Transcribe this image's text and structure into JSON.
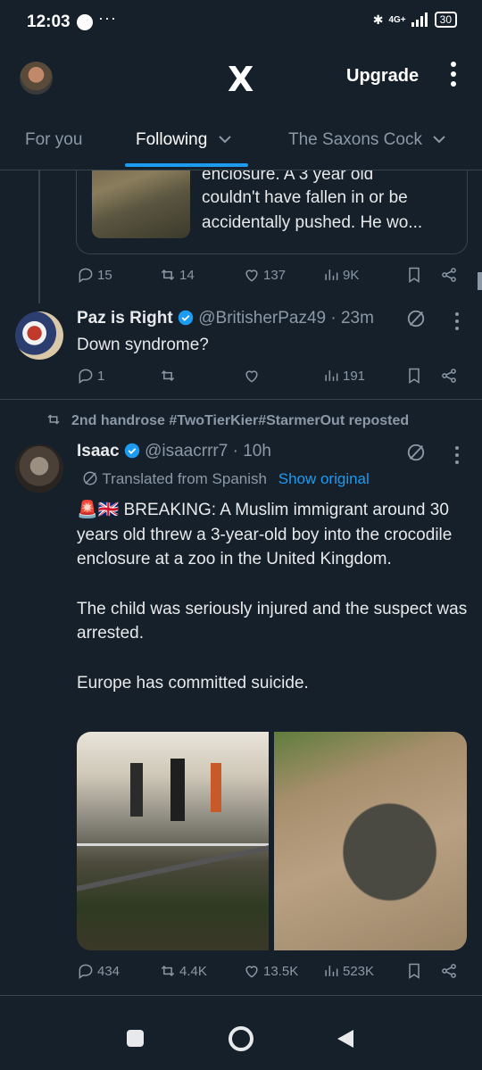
{
  "status_bar": {
    "time": "12:03",
    "network": "4G+",
    "battery": "30",
    "more": "···"
  },
  "header": {
    "logo": "X",
    "upgrade_label": "Upgrade"
  },
  "tabs": [
    {
      "label": "For you",
      "active": false
    },
    {
      "label": "Following",
      "active": true
    },
    {
      "label": "The Saxons Cock",
      "active": false
    }
  ],
  "quoted_tweet": {
    "text_lines": [
      "enclosure. A 3 year old",
      "couldn't have fallen  in or be",
      "accidentally pushed. He wo..."
    ]
  },
  "tweet1_actions": {
    "replies": "15",
    "reposts": "14",
    "likes": "137",
    "views": "9K"
  },
  "tweet2": {
    "name": "Paz is Right",
    "handle": "@BritisherPaz49",
    "time": "· 23m",
    "text": "Down syndrome?",
    "actions": {
      "replies": "1",
      "reposts": "",
      "likes": "",
      "views": "191"
    }
  },
  "tweet3": {
    "repost_label": "2nd handrose #TwoTierKier#StarmerOut reposted",
    "name": "Isaac",
    "handle": "@isaacrrr7",
    "time": "· 10h",
    "translated_label": "Translated from Spanish",
    "show_original": "Show original",
    "paragraphs": [
      "🚨🇬🇧 BREAKING: A Muslim immigrant around 30 years old threw a 3-year-old boy into the crocodile enclosure at a zoo in the United Kingdom.",
      "The child was seriously injured and the suspect was arrested.",
      "Europe has committed suicide."
    ],
    "actions": {
      "replies": "434",
      "reposts": "4.4K",
      "likes": "13.5K",
      "views": "523K"
    }
  },
  "colors": {
    "background": "#15202b",
    "accent": "#1d9bf0",
    "muted": "#8b98a5",
    "divider": "#38444d"
  }
}
